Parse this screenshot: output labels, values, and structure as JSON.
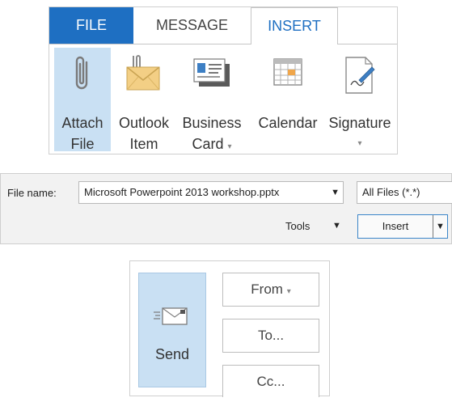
{
  "ribbon": {
    "tabs": [
      {
        "label": "FILE"
      },
      {
        "label": "MESSAGE"
      },
      {
        "label": "INSERT"
      }
    ],
    "buttons": {
      "attach": {
        "line1": "Attach",
        "line2": "File",
        "icon": "paperclip-icon"
      },
      "outlook": {
        "line1": "Outlook",
        "line2": "Item",
        "icon": "envelope-icon"
      },
      "business": {
        "line1": "Business",
        "line2": "Card",
        "icon": "business-card-icon"
      },
      "calendar": {
        "line1": "Calendar",
        "icon": "calendar-icon"
      },
      "signature": {
        "line1": "Signature",
        "icon": "signature-icon"
      }
    }
  },
  "dialog": {
    "filename_label": "File name:",
    "filename_value": "Microsoft Powerpoint 2013 workshop.pptx",
    "filter_value": "All Files (*.*)",
    "tools_label": "Tools",
    "insert_label": "Insert"
  },
  "compose": {
    "send_label": "Send",
    "from_label": "From",
    "to_label": "To...",
    "cc_label": "Cc..."
  },
  "colors": {
    "accent": "#1e6fc2",
    "selected_bg": "#c9e0f3"
  }
}
